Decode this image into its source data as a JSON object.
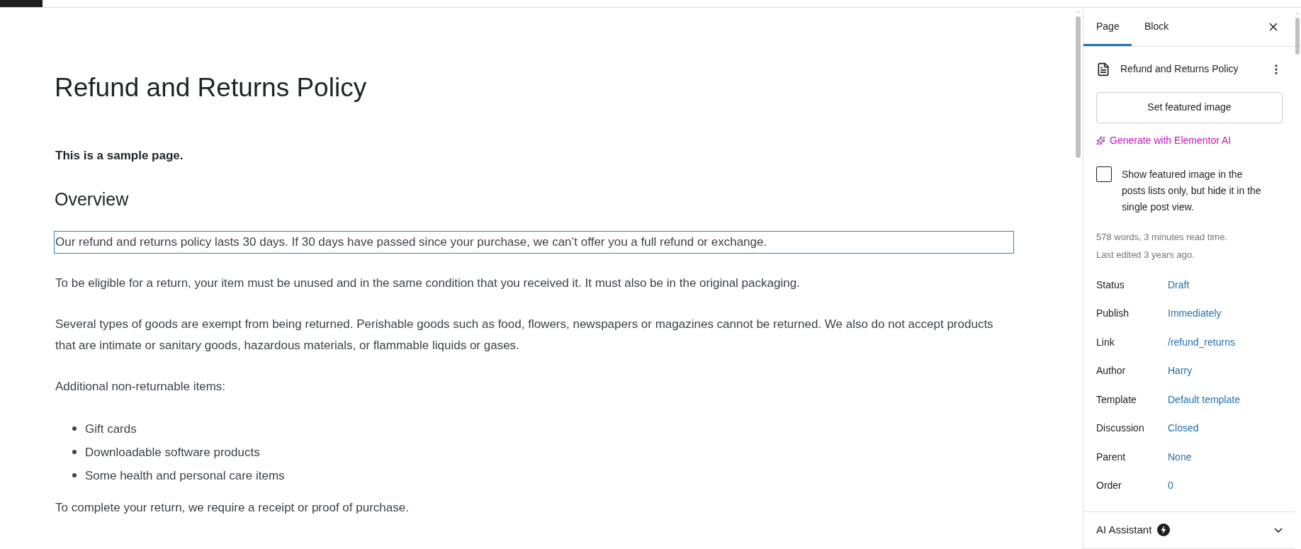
{
  "title": "Refund and Returns Policy",
  "blocks": [
    {
      "kind": "paragraph",
      "text": "This is a sample page.",
      "bold": true,
      "selected": false
    },
    {
      "kind": "heading",
      "text": "Overview"
    },
    {
      "kind": "paragraph",
      "text": "Our refund and returns policy lasts 30 days. If 30 days have passed since your purchase, we can’t offer you a full refund or exchange.",
      "bold": false,
      "selected": true
    },
    {
      "kind": "paragraph",
      "text": "To be eligible for a return, your item must be unused and in the same condition that you received it. It must also be in the original packaging.",
      "bold": false,
      "selected": false
    },
    {
      "kind": "paragraph",
      "text": "Several types of goods are exempt from being returned. Perishable goods such as food, flowers, newspapers or magazines cannot be returned. We also do not accept products that are intimate or sanitary goods, hazardous materials, or flammable liquids or gases.",
      "bold": false,
      "selected": false
    },
    {
      "kind": "paragraph",
      "text": "Additional non-returnable items:",
      "bold": false,
      "selected": false
    },
    {
      "kind": "list",
      "items": [
        "Gift cards",
        "Downloadable software products",
        "Some health and personal care items"
      ]
    },
    {
      "kind": "paragraph",
      "text": "To complete your return, we require a receipt or proof of purchase.",
      "bold": false,
      "selected": false
    }
  ],
  "sidebar": {
    "tabs": [
      {
        "label": "Page",
        "selected": true
      },
      {
        "label": "Block",
        "selected": false
      }
    ],
    "document_title": "Refund and Returns Policy",
    "featured_button": "Set featured image",
    "ai_link": "Generate with Elementor AI",
    "checkbox": {
      "label": "Show featured image in the posts lists only, but hide it in the single post view.",
      "checked": false
    },
    "stats": [
      "578 words, 3 minutes read time.",
      "Last edited 3 years ago."
    ],
    "rows": [
      {
        "label": "Status",
        "value": "Draft"
      },
      {
        "label": "Publish",
        "value": "Immediately"
      },
      {
        "label": "Link",
        "value": "/refund_returns"
      },
      {
        "label": "Author",
        "value": "Harry"
      },
      {
        "label": "Template",
        "value": "Default template"
      },
      {
        "label": "Discussion",
        "value": "Closed"
      },
      {
        "label": "Parent",
        "value": "None"
      },
      {
        "label": "Order",
        "value": "0"
      }
    ],
    "panel": {
      "title": "AI Assistant",
      "expanded": false
    }
  }
}
